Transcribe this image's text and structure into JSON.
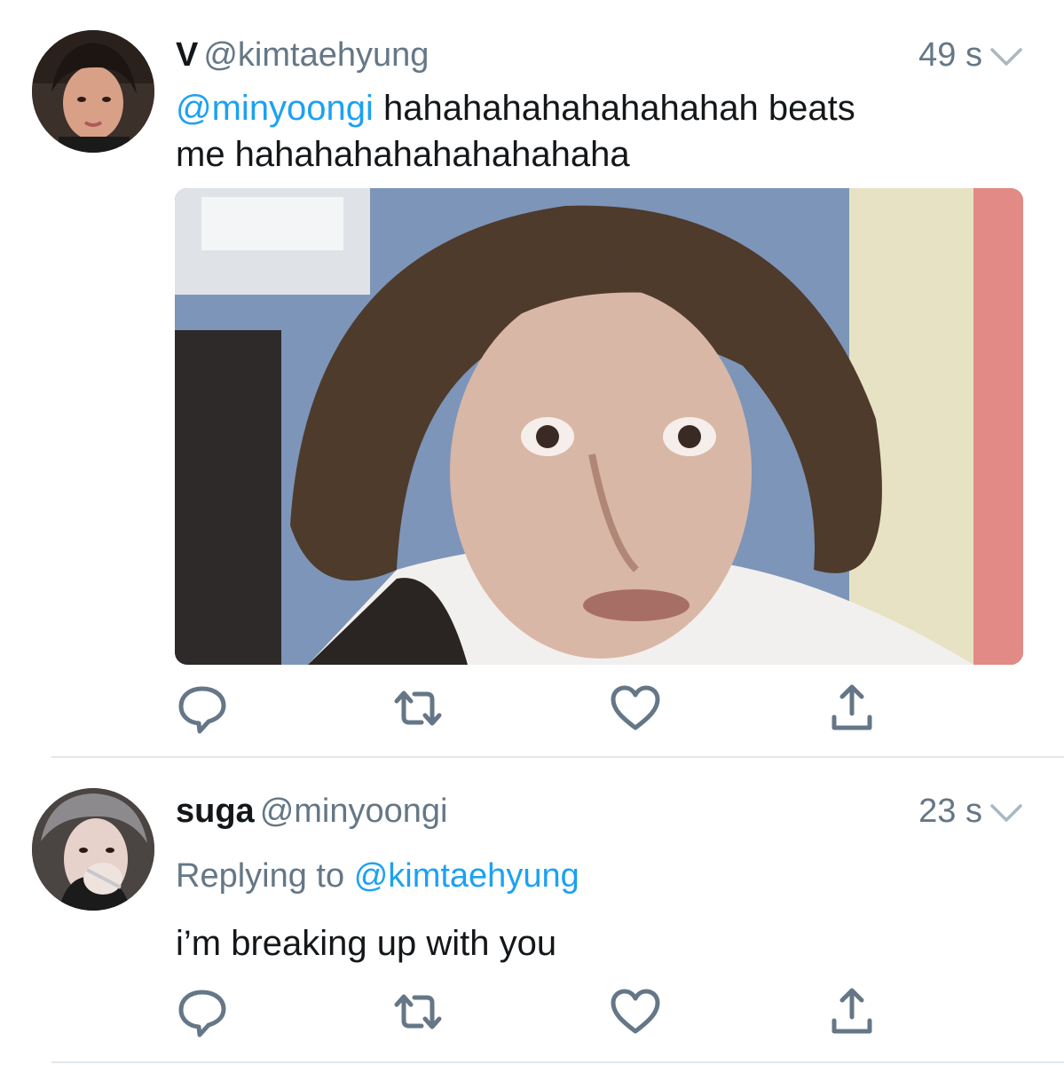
{
  "tweets": [
    {
      "name": "V",
      "handle": "@kimtaehyung",
      "time": "49 s",
      "mention": "@minyoongi",
      "text_line1": " hahahahahahahahahah beats",
      "text_line2": "me hahahahahahahahahaha",
      "avatar_icon": "profile-photo"
    },
    {
      "name": "suga",
      "handle": "@minyoongi",
      "time": "23 s",
      "replying_label": "Replying to",
      "replying_mention": "@kimtaehyung",
      "text": "i’m breaking up with you",
      "avatar_icon": "profile-photo"
    }
  ],
  "action_icons": [
    "reply-icon",
    "retweet-icon",
    "like-icon",
    "share-icon"
  ],
  "colors": {
    "link": "#1da1f2",
    "secondary": "#657786",
    "icon": "#657786",
    "divider": "#e1e8ed"
  }
}
